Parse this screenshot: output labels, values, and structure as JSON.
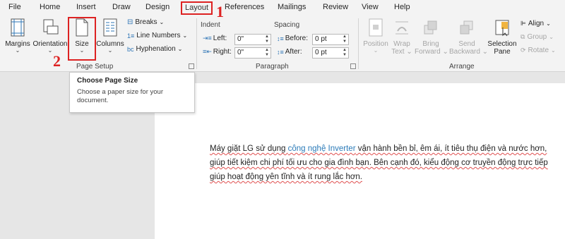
{
  "menu": {
    "tabs": [
      "File",
      "Home",
      "Insert",
      "Draw",
      "Design",
      "Layout",
      "References",
      "Mailings",
      "Review",
      "View",
      "Help"
    ],
    "active_tab": "Layout"
  },
  "ribbon": {
    "page_setup": {
      "margins": "Margins",
      "orientation": "Orientation",
      "size": "Size",
      "columns": "Columns",
      "breaks": "Breaks",
      "line_numbers": "Line Numbers",
      "hyphenation": "Hyphenation",
      "label": "Page Setup"
    },
    "paragraph": {
      "indent_caption": "Indent",
      "spacing_caption": "Spacing",
      "left_label": "Left:",
      "right_label": "Right:",
      "before_label": "Before:",
      "after_label": "After:",
      "left_value": "0\"",
      "right_value": "0\"",
      "before_value": "0 pt",
      "after_value": "0 pt",
      "label": "Paragraph"
    },
    "arrange": {
      "position": "Position",
      "wrap_text": [
        "Wrap",
        "Text"
      ],
      "bring_forward": [
        "Bring",
        "Forward"
      ],
      "send_backward": [
        "Send",
        "Backward"
      ],
      "selection_pane": [
        "Selection",
        "Pane"
      ],
      "align": "Align",
      "group": "Group",
      "rotate": "Rotate",
      "label": "Arrange"
    }
  },
  "annotations": {
    "step1": "1",
    "step2": "2"
  },
  "tooltip": {
    "title": "Choose Page Size",
    "body": "Choose a paper size for your document."
  },
  "document": {
    "text_before_link": "Máy giặt LG sử dụng ",
    "link_text": "công nghệ Inverter",
    "text_after_link": " vận hành bền bỉ, êm ái, ít tiêu thụ điện và nước hơn, giúp tiết kiệm chi phí tối ưu cho gia đình bạn. Bên cạnh đó, kiểu động cơ truyền động trực tiếp giúp hoạt động yên tĩnh và ít rung lắc hơn."
  },
  "colors": {
    "annotation_red": "#dd2222",
    "link_blue": "#2a7ab8",
    "ribbon_bg": "#f3f3f3",
    "canvas_bg": "#e6e6e6"
  }
}
